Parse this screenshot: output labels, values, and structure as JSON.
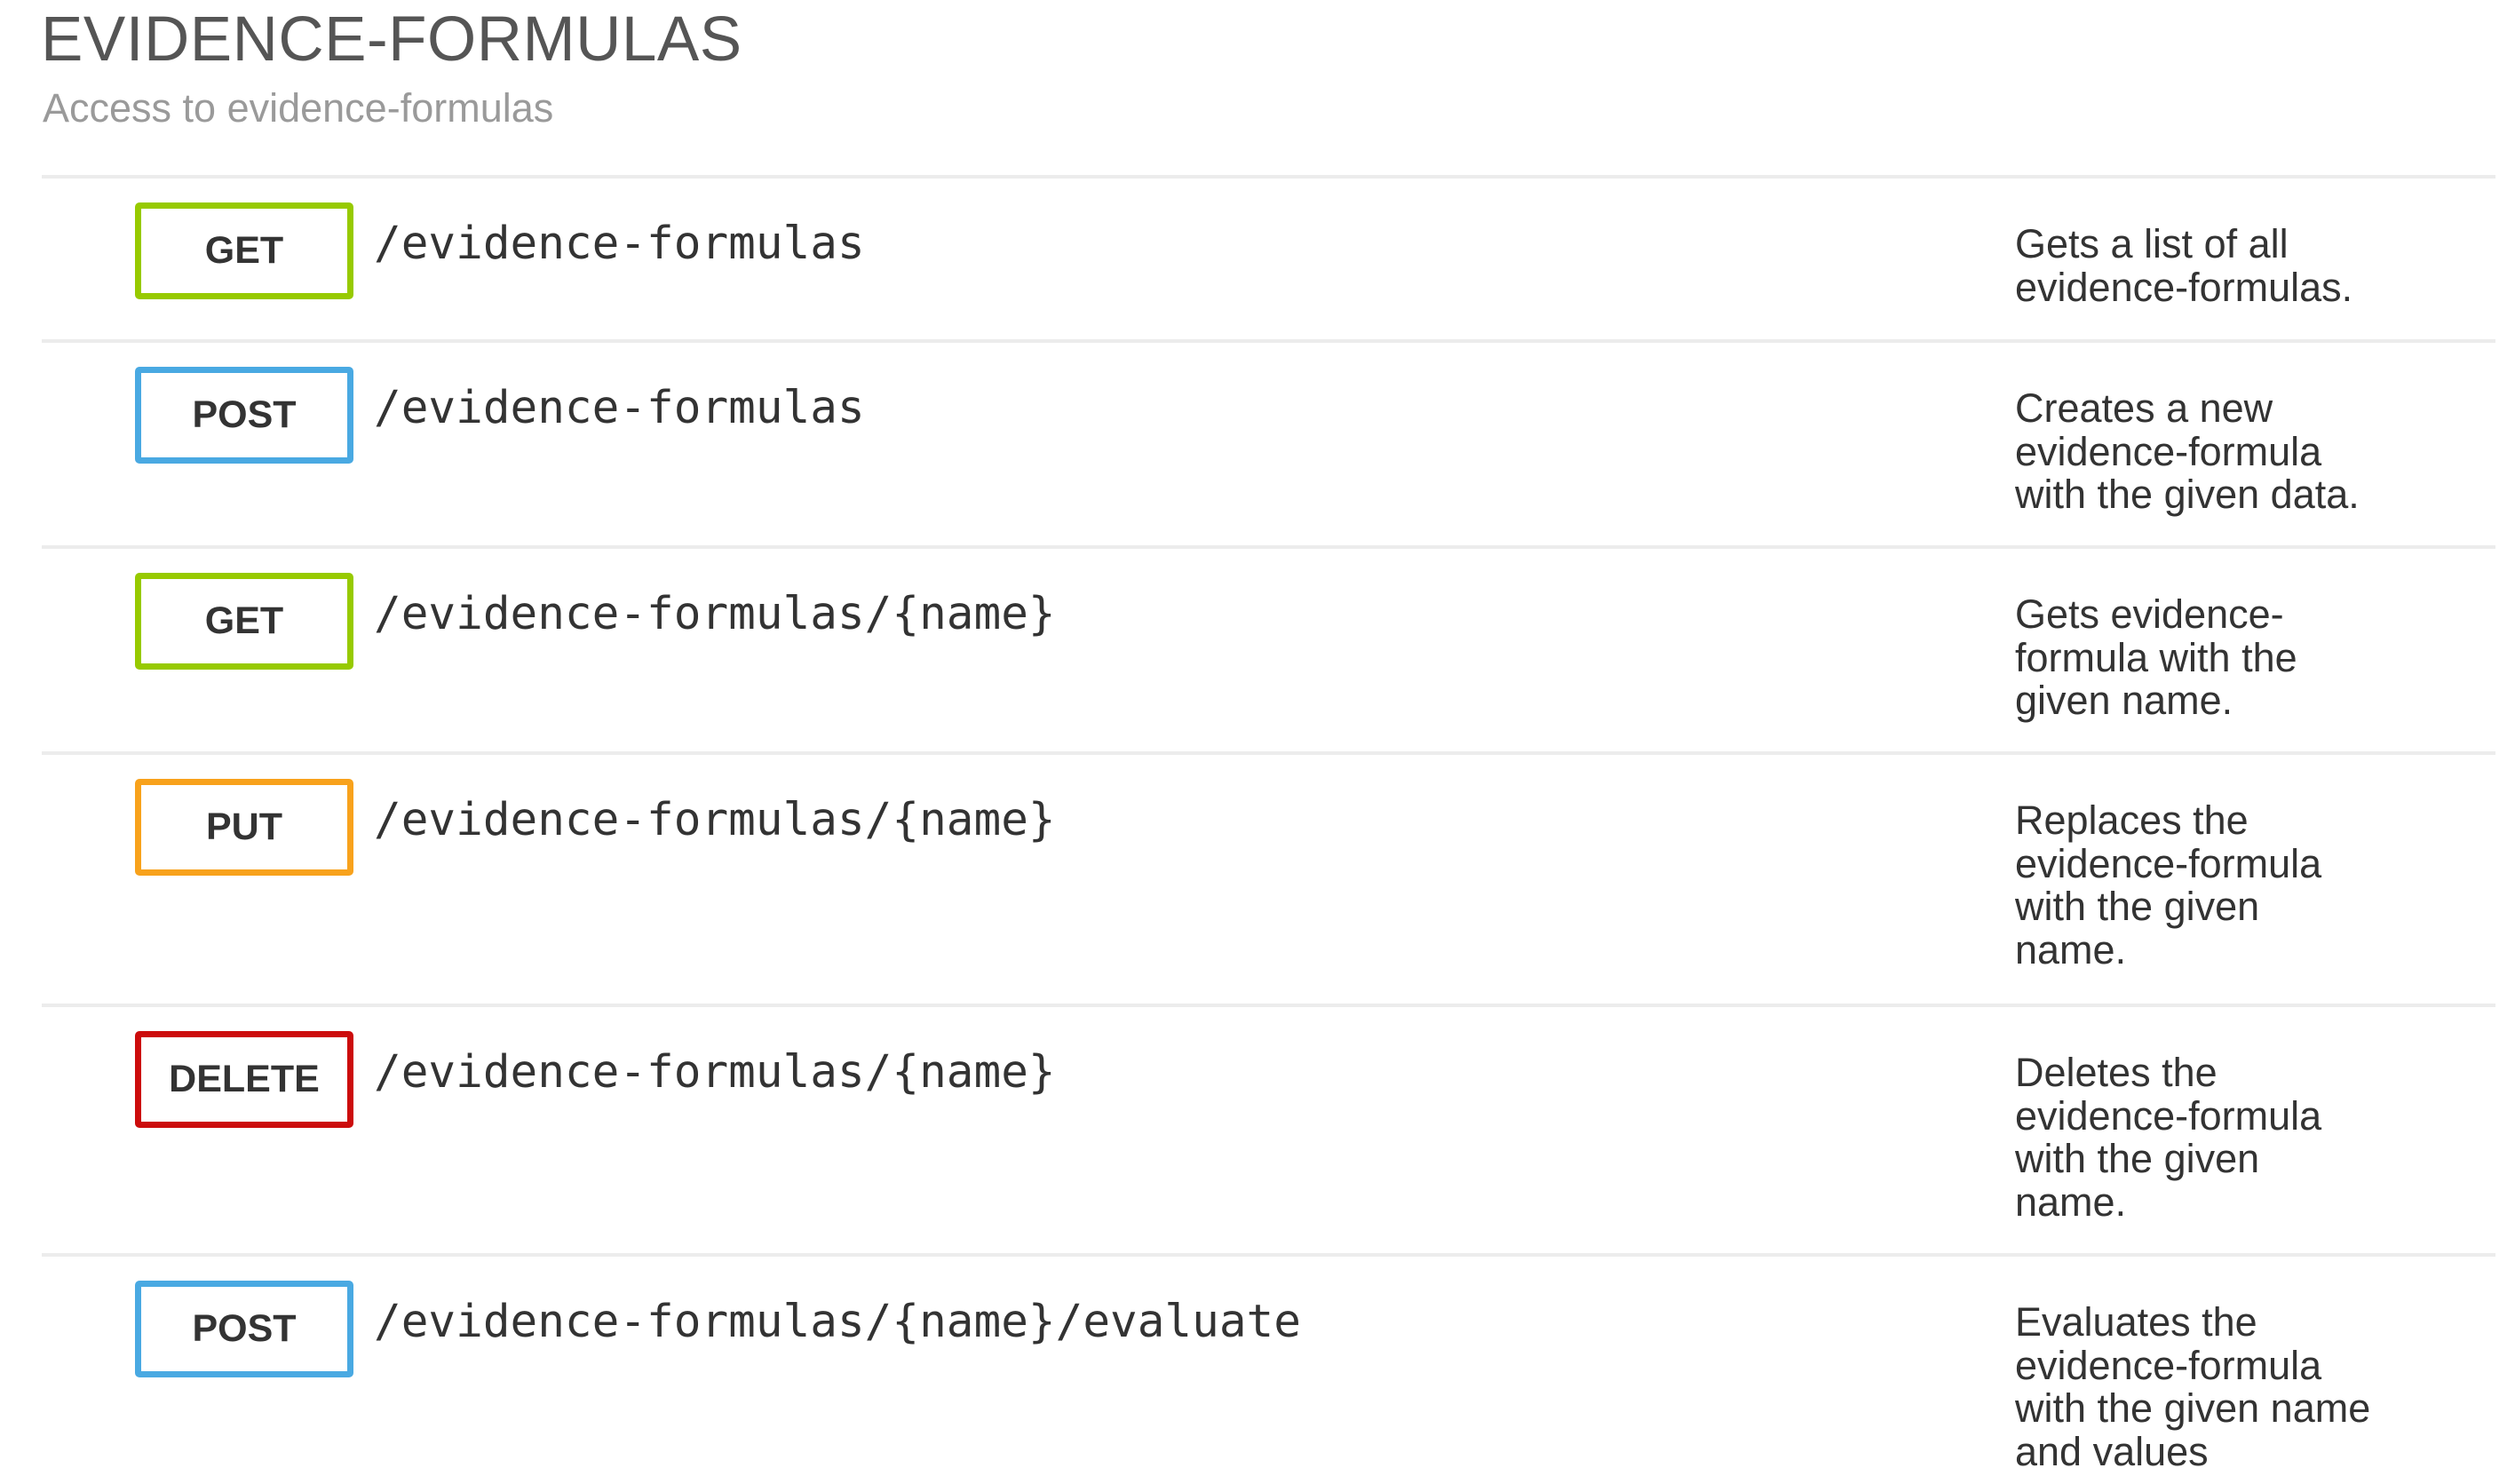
{
  "section": {
    "title": "EVIDENCE-FORMULAS",
    "subtitle": "Access to evidence-formulas"
  },
  "method_colors": {
    "GET": "#97ca00",
    "POST": "#49a9e2",
    "PUT": "#f8a21c",
    "DELETE": "#cc0c0c"
  },
  "operations": [
    {
      "method": "GET",
      "path": "/evidence-formulas",
      "description": "Gets a list of all\nevidence-formulas."
    },
    {
      "method": "POST",
      "path": "/evidence-formulas",
      "description": "Creates a new\nevidence-formula\nwith the given data."
    },
    {
      "method": "GET",
      "path": "/evidence-formulas/{name}",
      "description": "Gets evidence-\nformula with the\ngiven name."
    },
    {
      "method": "PUT",
      "path": "/evidence-formulas/{name}",
      "description": "Replaces the\nevidence-formula\nwith the given\nname."
    },
    {
      "method": "DELETE",
      "path": "/evidence-formulas/{name}",
      "description": "Deletes the\nevidence-formula\nwith the given\nname."
    },
    {
      "method": "POST",
      "path": "/evidence-formulas/{name}/evaluate",
      "description": "Evaluates the\nevidence-formula\nwith the given name\nand values"
    }
  ]
}
